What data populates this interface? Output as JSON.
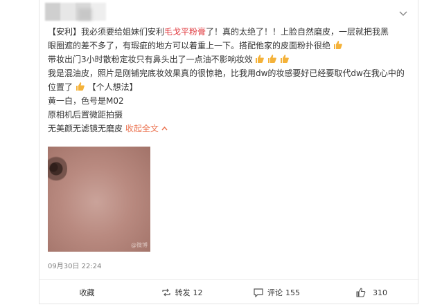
{
  "post": {
    "line1_a": "【安利】我必须要给姐妹们安利",
    "line1_red": "毛戈平粉膏",
    "line1_b": "了！真的太绝了！！上脸自然磨皮，一层就把我黑",
    "line2": "眼圈遮的差不多了，有瑕疵的地方可以着重上一下。搭配他家的皮面粉扑很绝",
    "line3": "带妆出门3小时散粉定妆只有鼻头出了一点油不影响妆效",
    "line4": "我是混油皮，照片是刚铺完底妆效果真的很惊艳，比我用dw的妆感要好已经要取代dw在我心中的",
    "line5": "位置了",
    "line5_tag": "【个人想法】",
    "line6": "黄一白，色号是M02",
    "line7": "原相机后置微距拍摄",
    "line8": "无美颜无滤镜无磨皮",
    "expand": "收起全文",
    "photo_watermark": "@微博",
    "time": "09月30日 22:24"
  },
  "actions": {
    "fav_label": "收藏",
    "repost_label": "转发",
    "repost_count": "12",
    "comment_label": "评论",
    "comment_count": "155",
    "like_count": "310"
  },
  "colors": {
    "highlight": "#e0393e",
    "link": "#eb7350",
    "emoji": "#f4b23a"
  }
}
